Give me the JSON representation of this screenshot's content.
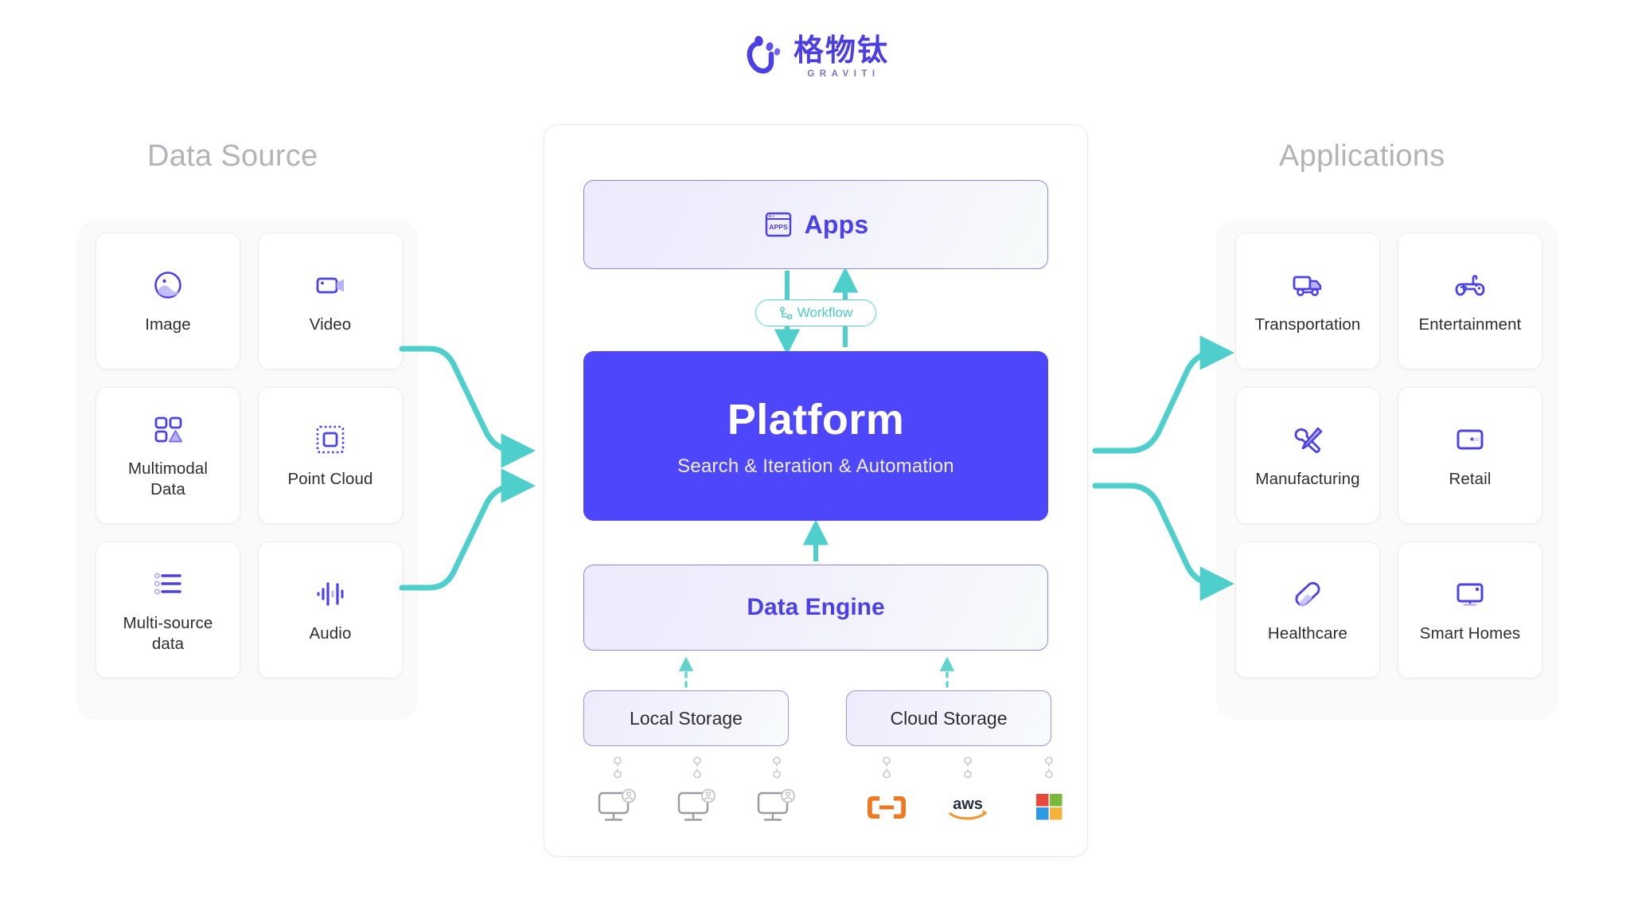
{
  "logo": {
    "icon_name": "graviti-logo-icon",
    "cn_name": "格物钛",
    "en_name": "GRAVITI",
    "brand_color": "#4b3fe4"
  },
  "columns": {
    "left_title": "Data Source",
    "right_title": "Applications",
    "title_color": "#b3b3b8"
  },
  "data_source_cards": [
    {
      "label": "Image",
      "icon": "image-circle-icon"
    },
    {
      "label": "Video",
      "icon": "video-camera-icon"
    },
    {
      "label": "Multimodal\nData",
      "icon": "multimodal-shapes-icon"
    },
    {
      "label": "Point Cloud",
      "icon": "point-cloud-icon"
    },
    {
      "label": "Multi-source\ndata",
      "icon": "multi-source-list-icon"
    },
    {
      "label": "Audio",
      "icon": "audio-waveform-icon"
    }
  ],
  "application_cards": [
    {
      "label": "Transportation",
      "icon": "truck-icon"
    },
    {
      "label": "Entertainment",
      "icon": "gamepad-icon"
    },
    {
      "label": "Manufacturing",
      "icon": "wrench-screwdriver-icon"
    },
    {
      "label": "Retail",
      "icon": "retail-screen-icon"
    },
    {
      "label": "Healthcare",
      "icon": "pill-capsule-icon"
    },
    {
      "label": "Smart Homes",
      "icon": "smart-monitor-icon"
    }
  ],
  "center": {
    "apps": {
      "label": "Apps",
      "icon": "apps-browser-icon",
      "icon_text": "APPS"
    },
    "workflow": {
      "label": "Workflow",
      "icon": "workflow-branch-icon",
      "color": "#4ec9c4"
    },
    "platform": {
      "title": "Platform",
      "subtitle": "Search & Iteration & Automation",
      "bg_color": "#4e46fb"
    },
    "data_engine": {
      "label": "Data Engine",
      "color": "#4b41e8"
    },
    "local_storage": {
      "label": "Local Storage"
    },
    "cloud_storage": {
      "label": "Cloud Storage"
    },
    "local_nodes": [
      {
        "icon": "workstation-user-icon"
      },
      {
        "icon": "workstation-user-icon"
      },
      {
        "icon": "workstation-user-icon"
      }
    ],
    "cloud_nodes": [
      {
        "icon": "alibaba-cloud-logo"
      },
      {
        "icon": "aws-logo",
        "label": "aws"
      },
      {
        "icon": "microsoft-azure-logo"
      }
    ]
  },
  "connectors": {
    "arrow_color": "#4ecfcb",
    "dashed_arrow_color": "#5fd3cc"
  }
}
